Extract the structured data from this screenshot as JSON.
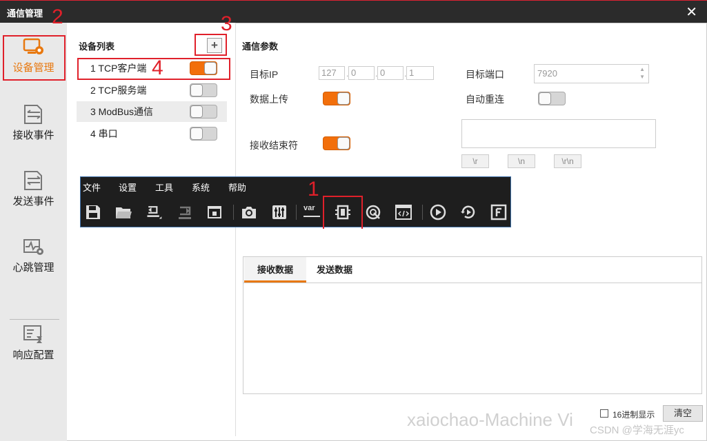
{
  "window": {
    "title": "通信管理",
    "close_icon": "close-icon"
  },
  "nav": [
    {
      "label": "设备管理",
      "icon": "device-settings-icon",
      "active": true
    },
    {
      "label": "接收事件",
      "icon": "receive-event-icon",
      "active": false
    },
    {
      "label": "发送事件",
      "icon": "send-event-icon",
      "active": false
    },
    {
      "label": "心跳管理",
      "icon": "heartbeat-icon",
      "active": false
    },
    {
      "label": "响应配置",
      "icon": "response-config-icon",
      "active": false
    }
  ],
  "device_list": {
    "title": "设备列表",
    "add_label": "+",
    "items": [
      {
        "label": "1 TCP客户端",
        "enabled": true,
        "selected": false
      },
      {
        "label": "2 TCP服务端",
        "enabled": false,
        "selected": false
      },
      {
        "label": "3 ModBus通信",
        "enabled": false,
        "selected": true
      },
      {
        "label": "4 串口",
        "enabled": false,
        "selected": false
      }
    ]
  },
  "params": {
    "title": "通信参数",
    "target_ip_label": "目标IP",
    "ip": [
      "127",
      "0",
      "0",
      "1"
    ],
    "target_port_label": "目标端口",
    "port_value": "7920",
    "upload_label": "数据上传",
    "upload_on": true,
    "reconnect_label": "自动重连",
    "reconnect_on": false,
    "end_char_label": "接收结束符",
    "end_char_on": true,
    "end_buttons": [
      "\\r",
      "\\n",
      "\\r\\n"
    ]
  },
  "menu_window": {
    "menus": [
      "文件",
      "设置",
      "工具",
      "系统",
      "帮助"
    ],
    "toolbar_icons": [
      "save-icon",
      "open-folder-icon",
      "undo-icon",
      "redo-icon",
      "lock-icon",
      "camera-icon",
      "sliders-icon",
      "var-icon",
      "communication-icon",
      "target-icon",
      "code-icon",
      "play-icon",
      "cycle-run-icon",
      "f-icon"
    ],
    "var_text": "var"
  },
  "data_tabs": {
    "tabs": [
      "接收数据",
      "发送数据"
    ],
    "active": 0
  },
  "footer": {
    "hex_label": "16进制显示",
    "clear_label": "清空"
  },
  "annotations": {
    "n1": "1",
    "n2": "2",
    "n3": "3",
    "n4": "4"
  },
  "watermark": "xaiochao-Machine Vi",
  "credit": "CSDN @学海无涯yc",
  "colors": {
    "accent": "#f26f0b",
    "annotation": "#e0202a",
    "titlebar": "#2b2b2b"
  }
}
